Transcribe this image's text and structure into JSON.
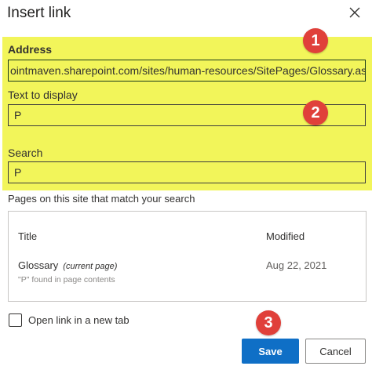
{
  "dialog": {
    "title": "Insert link",
    "close_icon": "close-icon"
  },
  "colors": {
    "highlight": "#f2f55a",
    "callout": "#e0403a",
    "primary_button": "#0f6fc6"
  },
  "address": {
    "label": "Address",
    "value": "ointmaven.sharepoint.com/sites/human-resources/SitePages/Glossary.aspx#p"
  },
  "display_text": {
    "label": "Text to display",
    "value": "P"
  },
  "search": {
    "label": "Search",
    "value": "P"
  },
  "results": {
    "heading": "Pages on this site that match your search",
    "columns": {
      "title": "Title",
      "modified": "Modified"
    },
    "rows": [
      {
        "name": "Glossary",
        "tag": "(current page)",
        "detail": "\"P\" found in page contents",
        "modified": "Aug 22, 2021"
      }
    ]
  },
  "new_tab": {
    "label": "Open link in a new tab",
    "checked": false
  },
  "buttons": {
    "save": "Save",
    "cancel": "Cancel"
  },
  "callouts": [
    "1",
    "2",
    "3"
  ]
}
